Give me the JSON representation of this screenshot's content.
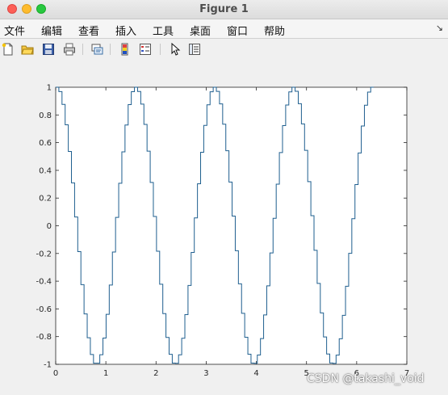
{
  "window": {
    "title": "Figure 1"
  },
  "menubar": {
    "items": [
      "文件",
      "编辑",
      "查看",
      "插入",
      "工具",
      "桌面",
      "窗口",
      "帮助"
    ],
    "overflow_label": "↘"
  },
  "toolbar": {
    "icons": [
      "new-figure-icon",
      "open-file-icon",
      "save-icon",
      "print-icon",
      "link-plot-icon",
      "insert-colorbar-icon",
      "insert-legend-icon",
      "edit-plot-arrow-icon",
      "property-inspector-icon"
    ]
  },
  "colors": {
    "line": "#1f5f8f",
    "axes_bg": "#ffffff",
    "figure_bg": "#f0f0f0"
  },
  "chart_data": {
    "type": "line",
    "style": "stairs",
    "title": "",
    "xlabel": "",
    "ylabel": "",
    "xlim": [
      0,
      7
    ],
    "ylim": [
      -1,
      1
    ],
    "xticks": [
      0,
      1,
      2,
      3,
      4,
      5,
      6,
      7
    ],
    "yticks": [
      -1,
      -0.8,
      -0.6,
      -0.4,
      -0.2,
      0,
      0.2,
      0.4,
      0.6,
      0.8,
      1
    ],
    "xtick_labels": [
      "0",
      "1",
      "2",
      "3",
      "4",
      "5",
      "6",
      "7"
    ],
    "ytick_labels": [
      "-1",
      "-0.8",
      "-0.6",
      "-0.4",
      "-0.2",
      "0",
      "0.2",
      "0.4",
      "0.6",
      "0.8",
      "1"
    ],
    "grid": false,
    "series": [
      {
        "function": "cos(4x)",
        "x_start": 0,
        "x_end": 6.2832,
        "step": 0.0628
      }
    ]
  },
  "watermark": "CSDN @takashi_void"
}
